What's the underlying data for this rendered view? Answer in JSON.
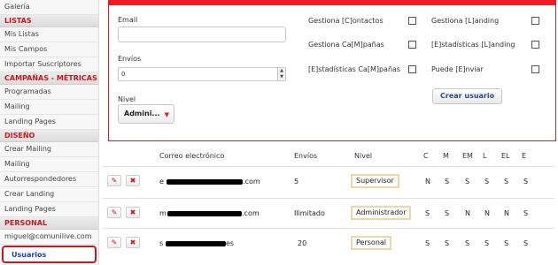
{
  "sidebar": {
    "top_item": "Galería",
    "sections": [
      {
        "title": "LISTAS",
        "items": [
          "Mis Listas",
          "Mis Campos",
          "Importar Suscriptores"
        ]
      },
      {
        "title": "CAMPAÑAS - MÉTRICAS",
        "items": [
          "Programadas",
          "Mailing",
          "Landing Pages"
        ]
      },
      {
        "title": "DISEÑO",
        "items": [
          "Crear Mailing",
          "Mailing",
          "Autorrespondedores",
          "Crear Landing",
          "Landing Pages"
        ]
      },
      {
        "title": "PERSONAL",
        "items": [
          "miguel@comunilive.com"
        ]
      }
    ],
    "active_item": "Usuarios"
  },
  "form": {
    "email_label": "Email",
    "email_value": "",
    "envios_label": "Envíos",
    "envios_value": "0",
    "nivel_label": "Nivel",
    "nivel_value": "Admini...",
    "permissions": [
      {
        "label": "Gestiona [C]ontactos",
        "checked": false
      },
      {
        "label": "Gestiona Ca[M]pañas",
        "checked": false
      },
      {
        "label": "[E]stadísticas Ca[M]pañas",
        "checked": false
      },
      {
        "label": "Gestiona [L]anding",
        "checked": false
      },
      {
        "label": "[E]stadísticas [L]anding",
        "checked": false
      },
      {
        "label": "Puede [E]nviar",
        "checked": false
      }
    ],
    "create_button": "Crear usuario"
  },
  "table": {
    "headers": [
      "Correo electrónico",
      "Envíos",
      "Nivel",
      "C",
      "M",
      "EM",
      "L",
      "EL",
      "E"
    ],
    "rows": [
      {
        "email_start": "e",
        "email_end": ".com",
        "envios": "5",
        "nivel": "Supervisor",
        "perms": [
          "N",
          "S",
          "S",
          "S",
          "S",
          "S"
        ]
      },
      {
        "email_start": "m",
        "email_end": ".com",
        "envios": "Ilimitado",
        "nivel": "Administrador",
        "perms": [
          "S",
          "S",
          "N",
          "N",
          "N",
          "S"
        ]
      },
      {
        "email_start": "s",
        "email_end": "es",
        "envios": "20",
        "nivel": "Personal",
        "perms": [
          "S",
          "S",
          "S",
          "S",
          "S",
          "S"
        ]
      }
    ]
  },
  "colors": {
    "accent": "#ee1c24",
    "section_title": "#c9171e",
    "active_link": "#1a3fbf",
    "level_border": "#ecd7a5"
  },
  "icons": {
    "edit": "pencil-icon",
    "delete": "close-icon"
  }
}
